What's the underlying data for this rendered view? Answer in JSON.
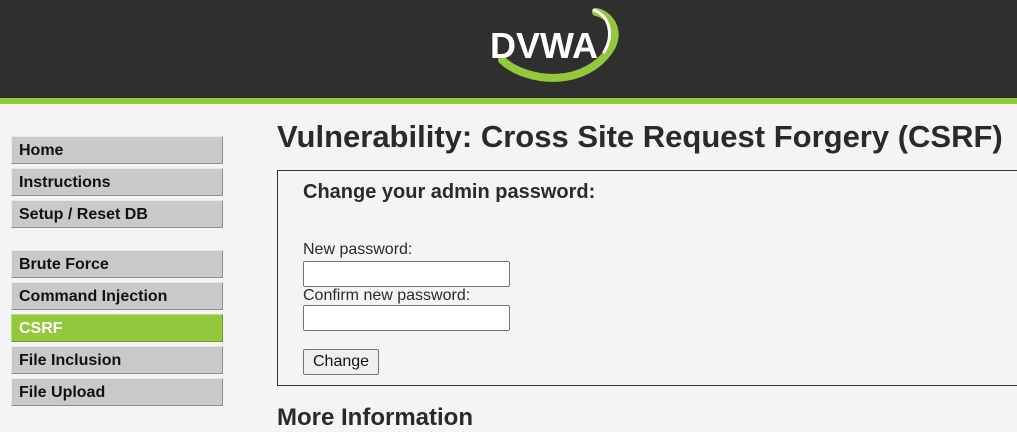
{
  "header": {
    "logo_text": "DVWA",
    "colors": {
      "background": "#2f2f2f",
      "accent": "#93c83c"
    }
  },
  "sidebar": {
    "groups": [
      {
        "items": [
          {
            "label": "Home",
            "selected": false
          },
          {
            "label": "Instructions",
            "selected": false
          },
          {
            "label": "Setup / Reset DB",
            "selected": false
          }
        ]
      },
      {
        "items": [
          {
            "label": "Brute Force",
            "selected": false
          },
          {
            "label": "Command Injection",
            "selected": false
          },
          {
            "label": "CSRF",
            "selected": true
          },
          {
            "label": "File Inclusion",
            "selected": false
          },
          {
            "label": "File Upload",
            "selected": false
          }
        ]
      }
    ]
  },
  "main": {
    "title": "Vulnerability: Cross Site Request Forgery (CSRF)",
    "form": {
      "heading": "Change your admin password:",
      "new_password_label": "New password:",
      "new_password_value": "",
      "confirm_password_label": "Confirm new password:",
      "confirm_password_value": "",
      "submit_label": "Change"
    },
    "more_info_heading": "More Information"
  }
}
